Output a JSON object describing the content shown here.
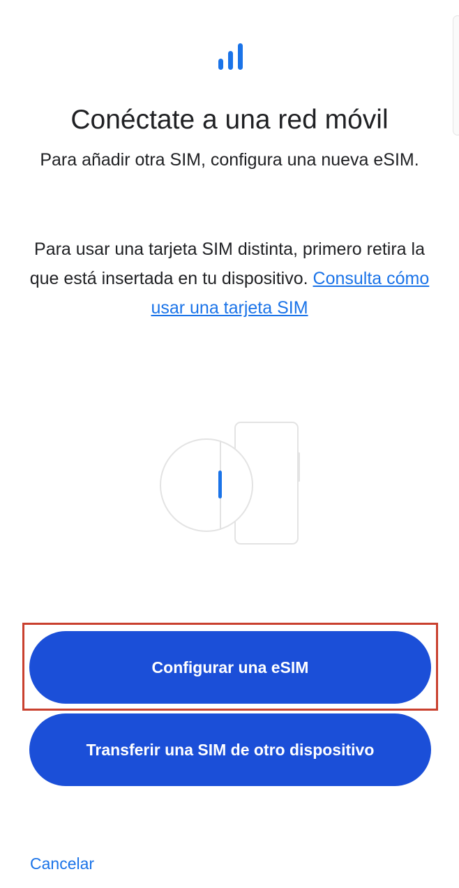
{
  "header": {
    "icon": "signal-bars-icon",
    "title": "Conéctate a una red móvil"
  },
  "body": {
    "paragraph_1": "Para añadir otra SIM, configura una nueva eSIM.",
    "paragraph_2_text": "Para usar una tarjeta SIM distinta, primero retira la que está insertada en tu dispositivo. ",
    "paragraph_2_link": "Consulta cómo usar una tarjeta SIM"
  },
  "illustration": {
    "icon": "sim-tray-illustration-icon"
  },
  "actions": {
    "primary_label": "Configurar una eSIM",
    "secondary_label": "Transferir una SIM de otro dispositivo",
    "cancel_label": "Cancelar"
  },
  "colors": {
    "accent": "#1b4fd8",
    "link": "#1a73e8",
    "highlight_border": "#c9402e",
    "text": "#202124"
  }
}
